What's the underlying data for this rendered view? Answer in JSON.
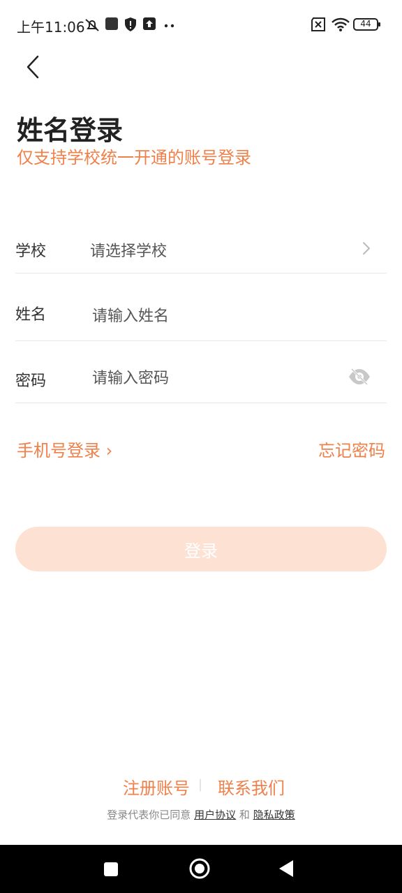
{
  "status_bar": {
    "time": "上午11:06",
    "battery": "44",
    "icons": [
      "mute-icon",
      "app-square-icon",
      "shield-icon",
      "upload-icon",
      "more-dots-icon",
      "sim-x-icon",
      "wifi-icon",
      "battery-icon"
    ]
  },
  "header": {
    "back_icon": "chevron-left-icon",
    "title": "姓名登录",
    "subtitle": "仅支持学校统一开通的账号登录"
  },
  "form": {
    "school": {
      "label": "学校",
      "value": "请选择学校"
    },
    "name": {
      "label": "姓名",
      "placeholder": "请输入姓名"
    },
    "password": {
      "label": "密码",
      "placeholder": "请输入密码"
    }
  },
  "links": {
    "phone_login": "手机号登录 ›",
    "forgot_password": "忘记密码"
  },
  "login_button": "登录",
  "footer": {
    "register": "注册账号",
    "separator": "|",
    "contact": "联系我们",
    "agreement_prefix": "登录代表你已同意",
    "user_agreement": "用户协议",
    "and": "和",
    "privacy_policy": "隐私政策"
  },
  "colors": {
    "accent": "#f0804a",
    "button_disabled": "#fde2d3"
  }
}
